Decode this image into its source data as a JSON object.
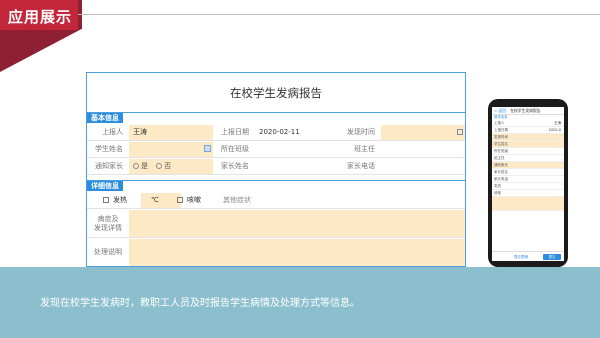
{
  "header": {
    "title": "应用展示"
  },
  "form": {
    "title": "在校学生发病报告",
    "basic_section": "基本信息",
    "detail_section": "详细信息",
    "rows": {
      "r1": {
        "reporter_label": "上报人",
        "reporter_value": "王涛",
        "date_label": "上报日期",
        "date_value": "2020-02-11",
        "time_label": "发现时间"
      },
      "r2": {
        "student_label": "学生姓名",
        "class_label": "所在班级",
        "teacher_label": "班主任"
      },
      "r3": {
        "notify_label": "通知家长",
        "yes": "是",
        "no": "否",
        "parent_label": "家长姓名",
        "phone_label": "家长电话"
      }
    },
    "detail": {
      "fever": "发热",
      "unit": "℃",
      "cough": "咳嗽",
      "other": "其他症状",
      "symptoms_label": "病症及\n发现详情",
      "handling_label": "处理说明"
    }
  },
  "phone": {
    "title": "在校学生发病报告",
    "back": "< 返回",
    "section_basic": "基本信息",
    "reporter_label": "上报人",
    "reporter_value": "王涛",
    "date_label": "上报日期",
    "date_value": "2020-0",
    "rows": [
      "发现时间",
      "学生姓名",
      "所在班级",
      "班主任",
      "通知家长",
      "家长姓名",
      "家长电话",
      "发热",
      "咳嗽"
    ],
    "footer_link": "提交草稿",
    "submit": "提交"
  },
  "caption": "发现在校学生发病时，教职工人员及时报告学生病情及处理方式等信息。"
}
